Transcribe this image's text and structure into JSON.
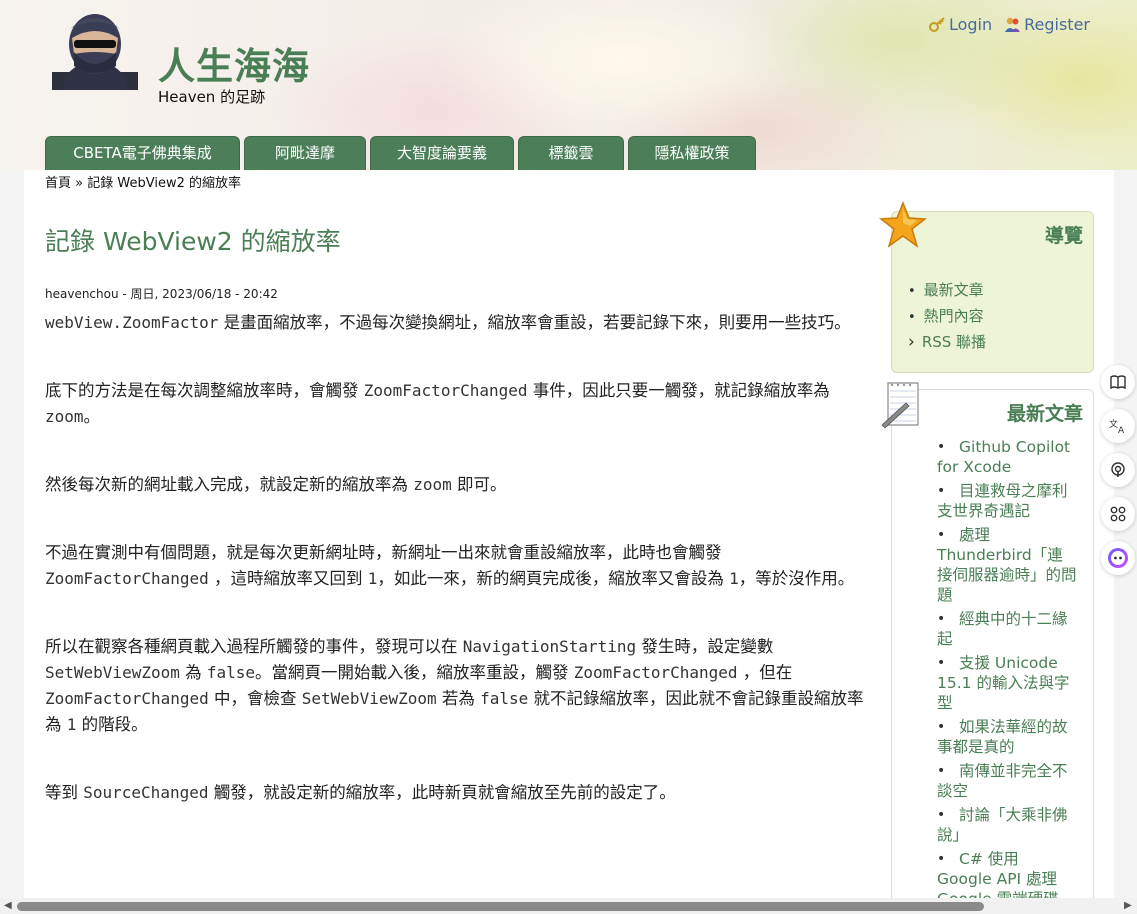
{
  "header": {
    "site_name": "人生海海",
    "slogan": "Heaven 的足跡",
    "login": "Login",
    "register": "Register"
  },
  "nav": {
    "tabs": [
      {
        "label": "CBETA電子佛典集成",
        "dropdown": false
      },
      {
        "label": "阿毗達摩",
        "dropdown": true
      },
      {
        "label": "大智度論要義",
        "dropdown": false
      },
      {
        "label": "標籤雲",
        "dropdown": true
      },
      {
        "label": "隱私權政策",
        "dropdown": false
      }
    ]
  },
  "breadcrumb": {
    "home": "首頁",
    "separator": "»",
    "current": "記錄 WebView2 的縮放率"
  },
  "article": {
    "title": "記錄 WebView2 的縮放率",
    "submitted": "heavenchou - 周日, 2023/06/18 - 20:42",
    "p1_code": "webView.ZoomFactor",
    "p1_text": " 是畫面縮放率，不過每次變換網址，縮放率會重設，若要記錄下來，則要用一些技巧。",
    "p2_a": "底下的方法是在每次調整縮放率時，會觸發 ",
    "p2_code1": "ZoomFactorChanged",
    "p2_b": " 事件，因此只要一觸發，就記錄縮放率為 ",
    "p2_code2": "zoom",
    "p2_c": "。",
    "p3_a": "然後每次新的網址載入完成，就設定新的縮放率為 ",
    "p3_code": "zoom",
    "p3_b": " 即可。",
    "p4_a": "不過在實測中有個問題，就是每次更新網址時，新網址一出來就會重設縮放率，此時也會觸發 ",
    "p4_code1": "ZoomFactorChanged",
    "p4_b": " ，這時縮放率又回到 ",
    "p4_code2": "1",
    "p4_c": "，如此一來，新的網頁完成後，縮放率又會設為 ",
    "p4_code3": "1",
    "p4_d": "，等於沒作用。",
    "p5_a": "所以在觀察各種網頁載入過程所觸發的事件，發現可以在 ",
    "p5_code1": "NavigationStarting",
    "p5_b": " 發生時，設定變數 ",
    "p5_code2": "SetWebViewZoom",
    "p5_c": " 為 ",
    "p5_code3": "false",
    "p5_d": "。當網頁一開始載入後，縮放率重設，觸發 ",
    "p5_code4": "ZoomFactorChanged",
    "p5_e": " ，但在 ",
    "p5_code5": "ZoomFactorChanged",
    "p5_f": " 中，會檢查 ",
    "p5_code6": "SetWebViewZoom",
    "p5_g": " 若為 ",
    "p5_code7": "false",
    "p5_h": " 就不記錄縮放率，因此就不會記錄重設縮放率為 ",
    "p5_code8": "1",
    "p5_i": " 的階段。",
    "p6_a": "等到 ",
    "p6_code": "SourceChanged",
    "p6_b": " 觸發，就設定新的縮放率，此時新頁就會縮放至先前的設定了。"
  },
  "sidebar": {
    "navigation": {
      "title": "導覽",
      "items": [
        "最新文章",
        "熱門內容",
        "RSS 聯播"
      ]
    },
    "recent": {
      "title": "最新文章",
      "items": [
        "Github Copilot for Xcode",
        "目連救母之摩利支世界奇遇記",
        "處理 Thunderbird「連接伺服器逾時」的問題",
        "經典中的十二緣起",
        "支援 Unicode 15.1 的輸入法與字型",
        "如果法華經的故事都是真的",
        "南傳並非完全不談空",
        "討論「大乘非佛說」",
        "C# 使用 Google API 處理 Google 雲端硬碟（下）程"
      ]
    }
  },
  "icons": {
    "login": "key-icon",
    "register": "users-icon",
    "nav_block": "star-icon",
    "recent_block": "notepad-icon",
    "float_bar": [
      "book-icon",
      "translate-icon",
      "podcast-icon",
      "apps-icon",
      "assistant-icon"
    ]
  },
  "colors": {
    "accent_green": "#4c7f58",
    "title_green": "#4a7f55",
    "sidebar_bg": "#eef4d6",
    "link_blue": "#4a6a9a"
  }
}
